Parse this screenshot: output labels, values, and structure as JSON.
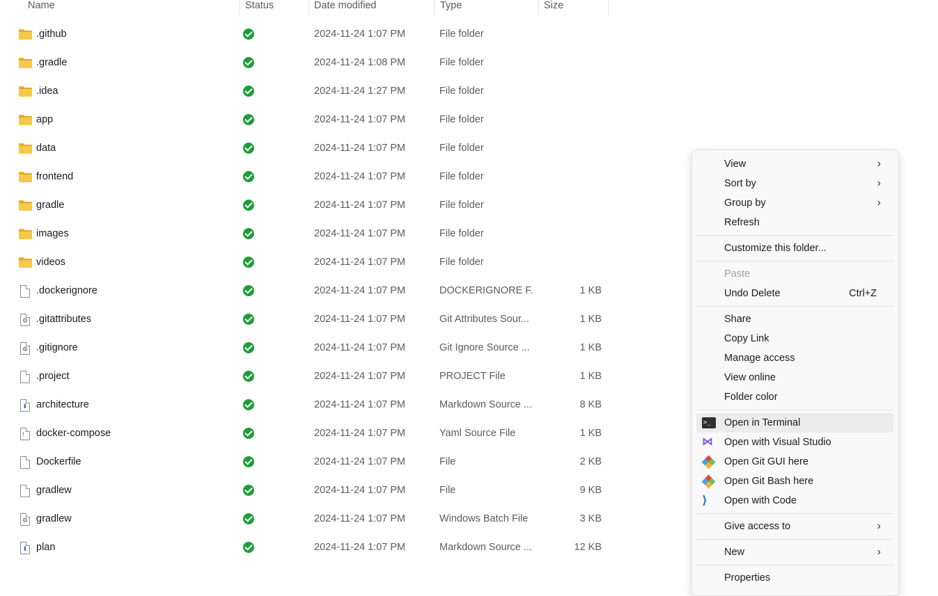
{
  "columns": {
    "name": "Name",
    "status": "Status",
    "date": "Date modified",
    "type": "Type",
    "size": "Size"
  },
  "files": [
    {
      "name": ".github",
      "icon": "folder-icon",
      "date": "2024-11-24 1:07 PM",
      "type": "File folder",
      "size": ""
    },
    {
      "name": ".gradle",
      "icon": "folder-icon",
      "date": "2024-11-24 1:08 PM",
      "type": "File folder",
      "size": ""
    },
    {
      "name": ".idea",
      "icon": "folder-icon",
      "date": "2024-11-24 1:27 PM",
      "type": "File folder",
      "size": ""
    },
    {
      "name": "app",
      "icon": "folder-icon",
      "date": "2024-11-24 1:07 PM",
      "type": "File folder",
      "size": ""
    },
    {
      "name": "data",
      "icon": "folder-icon",
      "date": "2024-11-24 1:07 PM",
      "type": "File folder",
      "size": ""
    },
    {
      "name": "frontend",
      "icon": "folder-icon",
      "date": "2024-11-24 1:07 PM",
      "type": "File folder",
      "size": ""
    },
    {
      "name": "gradle",
      "icon": "folder-icon",
      "date": "2024-11-24 1:07 PM",
      "type": "File folder",
      "size": ""
    },
    {
      "name": "images",
      "icon": "folder-icon",
      "date": "2024-11-24 1:07 PM",
      "type": "File folder",
      "size": ""
    },
    {
      "name": "videos",
      "icon": "folder-icon",
      "date": "2024-11-24 1:07 PM",
      "type": "File folder",
      "size": ""
    },
    {
      "name": ".dockerignore",
      "icon": "file-icon",
      "date": "2024-11-24 1:07 PM",
      "type": "DOCKERIGNORE F...",
      "size": "1 KB"
    },
    {
      "name": ".gitattributes",
      "icon": "settings-file-icon",
      "date": "2024-11-24 1:07 PM",
      "type": "Git Attributes Sour...",
      "size": "1 KB"
    },
    {
      "name": ".gitignore",
      "icon": "settings-file-icon",
      "date": "2024-11-24 1:07 PM",
      "type": "Git Ignore Source ...",
      "size": "1 KB"
    },
    {
      "name": ".project",
      "icon": "file-icon",
      "date": "2024-11-24 1:07 PM",
      "type": "PROJECT File",
      "size": "1 KB"
    },
    {
      "name": "architecture",
      "icon": "markdown-file-icon",
      "date": "2024-11-24 1:07 PM",
      "type": "Markdown Source ...",
      "size": "8 KB"
    },
    {
      "name": "docker-compose",
      "icon": "yaml-file-icon",
      "date": "2024-11-24 1:07 PM",
      "type": "Yaml Source File",
      "size": "1 KB"
    },
    {
      "name": "Dockerfile",
      "icon": "file-icon",
      "date": "2024-11-24 1:07 PM",
      "type": "File",
      "size": "2 KB"
    },
    {
      "name": "gradlew",
      "icon": "file-icon",
      "date": "2024-11-24 1:07 PM",
      "type": "File",
      "size": "9 KB"
    },
    {
      "name": "gradlew",
      "icon": "batch-file-icon",
      "date": "2024-11-24 1:07 PM",
      "type": "Windows Batch File",
      "size": "3 KB"
    },
    {
      "name": "plan",
      "icon": "markdown-file-icon",
      "date": "2024-11-24 1:07 PM",
      "type": "Markdown Source ...",
      "size": "12 KB"
    }
  ],
  "status_color": "#1e9e3a",
  "menu": {
    "view": "View",
    "sort_by": "Sort by",
    "group_by": "Group by",
    "refresh": "Refresh",
    "customize": "Customize this folder...",
    "paste": "Paste",
    "undo_delete": "Undo Delete",
    "undo_shortcut": "Ctrl+Z",
    "share": "Share",
    "copy_link": "Copy Link",
    "manage_access": "Manage access",
    "view_online": "View online",
    "folder_color": "Folder color",
    "open_terminal": "Open in Terminal",
    "open_vs": "Open with Visual Studio",
    "open_git_gui": "Open Git GUI here",
    "open_git_bash": "Open Git Bash here",
    "open_code": "Open with Code",
    "give_access": "Give access to",
    "new": "New",
    "properties": "Properties"
  }
}
